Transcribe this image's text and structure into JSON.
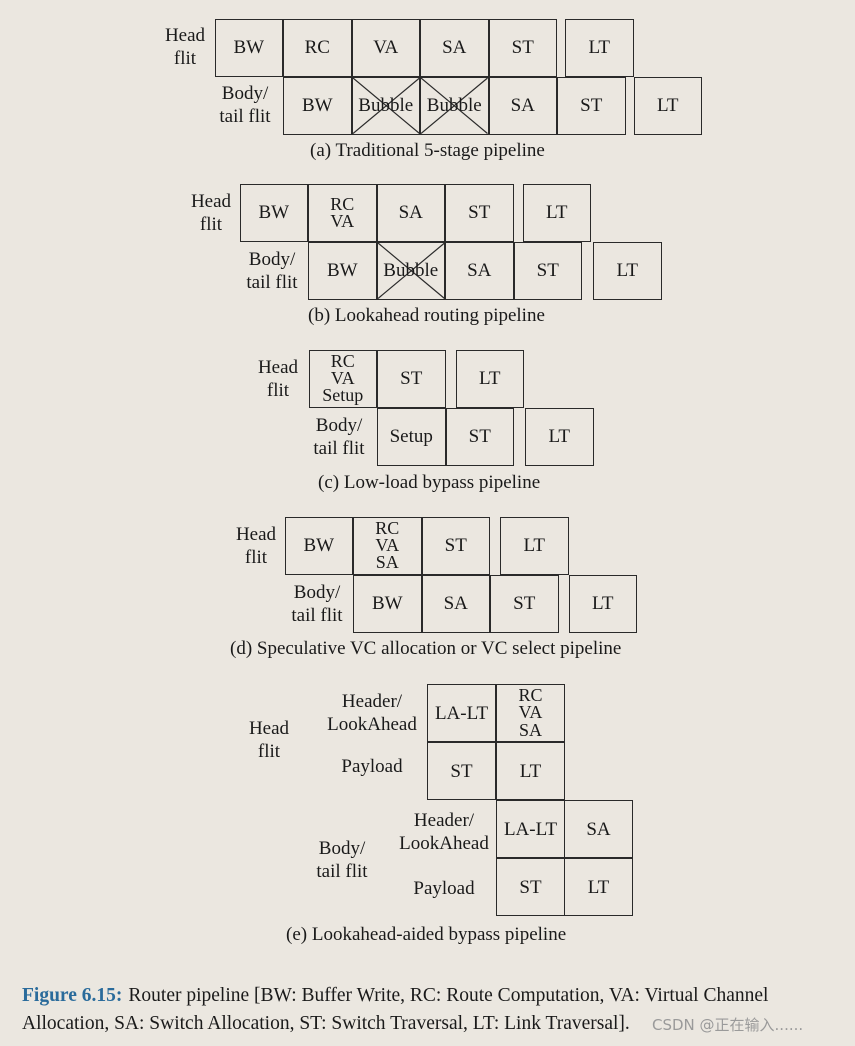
{
  "panels": [
    {
      "id": "a",
      "caption": "(a) Traditional 5-stage pipeline",
      "head_label": [
        "Head",
        "flit"
      ],
      "body_label": [
        "Body/",
        "tail flit"
      ],
      "head_stages": [
        "BW",
        "RC",
        "VA",
        "SA",
        "ST",
        "LT"
      ],
      "body_stages": [
        {
          "label": "BW",
          "bubble": false
        },
        {
          "label": "Bubble",
          "bubble": true
        },
        {
          "label": "Bubble",
          "bubble": true
        },
        {
          "label": "SA",
          "bubble": false
        },
        {
          "label": "ST",
          "bubble": false
        },
        {
          "label": "LT",
          "bubble": false
        }
      ]
    },
    {
      "id": "b",
      "caption": "(b) Lookahead routing pipeline",
      "head_label": [
        "Head",
        "flit"
      ],
      "body_label": [
        "Body/",
        "tail flit"
      ],
      "head_stages": [
        "BW",
        [
          "RC",
          "VA"
        ],
        "SA",
        "ST",
        "LT"
      ],
      "body_stages": [
        {
          "label": "BW",
          "bubble": false
        },
        {
          "label": "Bubble",
          "bubble": true
        },
        {
          "label": "SA",
          "bubble": false
        },
        {
          "label": "ST",
          "bubble": false
        },
        {
          "label": "LT",
          "bubble": false
        }
      ]
    },
    {
      "id": "c",
      "caption": "(c) Low-load bypass pipeline",
      "head_label": [
        "Head",
        "flit"
      ],
      "body_label": [
        "Body/",
        "tail flit"
      ],
      "head_stages": [
        [
          "RC",
          "VA",
          "Setup"
        ],
        "ST",
        "LT"
      ],
      "body_stages": [
        {
          "label": "Setup",
          "bubble": false
        },
        {
          "label": "ST",
          "bubble": false
        },
        {
          "label": "LT",
          "bubble": false
        }
      ]
    },
    {
      "id": "d",
      "caption": "(d) Speculative VC allocation or VC select pipeline",
      "head_label": [
        "Head",
        "flit"
      ],
      "body_label": [
        "Body/",
        "tail flit"
      ],
      "head_stages": [
        "BW",
        [
          "RC",
          "VA",
          "SA"
        ],
        "ST",
        "LT"
      ],
      "body_stages": [
        {
          "label": "BW",
          "bubble": false
        },
        {
          "label": "SA",
          "bubble": false
        },
        {
          "label": "ST",
          "bubble": false
        },
        {
          "label": "LT",
          "bubble": false
        }
      ]
    },
    {
      "id": "e",
      "caption": "(e) Lookahead-aided bypass pipeline",
      "head_label": [
        "Head",
        "flit"
      ],
      "body_label": [
        "Body/",
        "tail flit"
      ],
      "sublabels": {
        "header": [
          "Header/",
          "LookAhead"
        ],
        "payload": "Payload"
      },
      "head_header_stages": [
        "LA-LT",
        [
          "RC",
          "VA",
          "SA"
        ]
      ],
      "head_payload_stages": [
        "ST",
        "LT"
      ],
      "body_header_stages": [
        "LA-LT",
        "SA"
      ],
      "body_payload_stages": [
        "ST",
        "LT"
      ]
    }
  ],
  "figure_caption": {
    "label": "Figure 6.15:",
    "text": "Router pipeline [BW: Buffer Write, RC: Route Computation, VA: Virtual Channel Allocation, SA: Switch Allocation, ST: Switch Traversal, LT: Link Traversal]."
  },
  "watermark": "CSDN @正在输入......",
  "colors": {
    "background": "#ebe7e0",
    "stroke": "#2a2a2a",
    "figure_label": "#2a6b9b"
  }
}
